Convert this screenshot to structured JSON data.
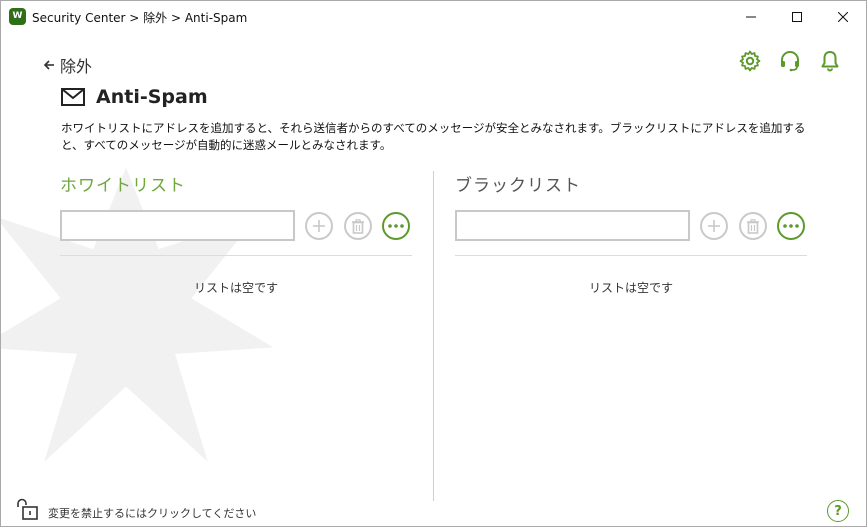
{
  "window": {
    "logo_text": "W",
    "title": "Security Center > 除外 > Anti-Spam"
  },
  "header": {
    "back_label": "除外",
    "icons": [
      "gear-icon",
      "headset-icon",
      "bell-icon"
    ]
  },
  "page": {
    "title": "Anti-Spam",
    "description": "ホワイトリストにアドレスを追加すると、それら送信者からのすべてのメッセージが安全とみなされます。ブラックリストにアドレスを追加すると、すべてのメッセージが自動的に迷惑メールとみなされます。"
  },
  "whitelist": {
    "title": "ホワイトリスト",
    "input_value": "",
    "empty_text": "リストは空です"
  },
  "blacklist": {
    "title": "ブラックリスト",
    "input_value": "",
    "empty_text": "リストは空です"
  },
  "footer": {
    "lock_text": "変更を禁止するにはクリックしてください",
    "help_label": "?"
  },
  "colors": {
    "accent": "#5b9a2b",
    "whitelist_title": "#72a63f",
    "disabled": "#c9c9c9"
  }
}
